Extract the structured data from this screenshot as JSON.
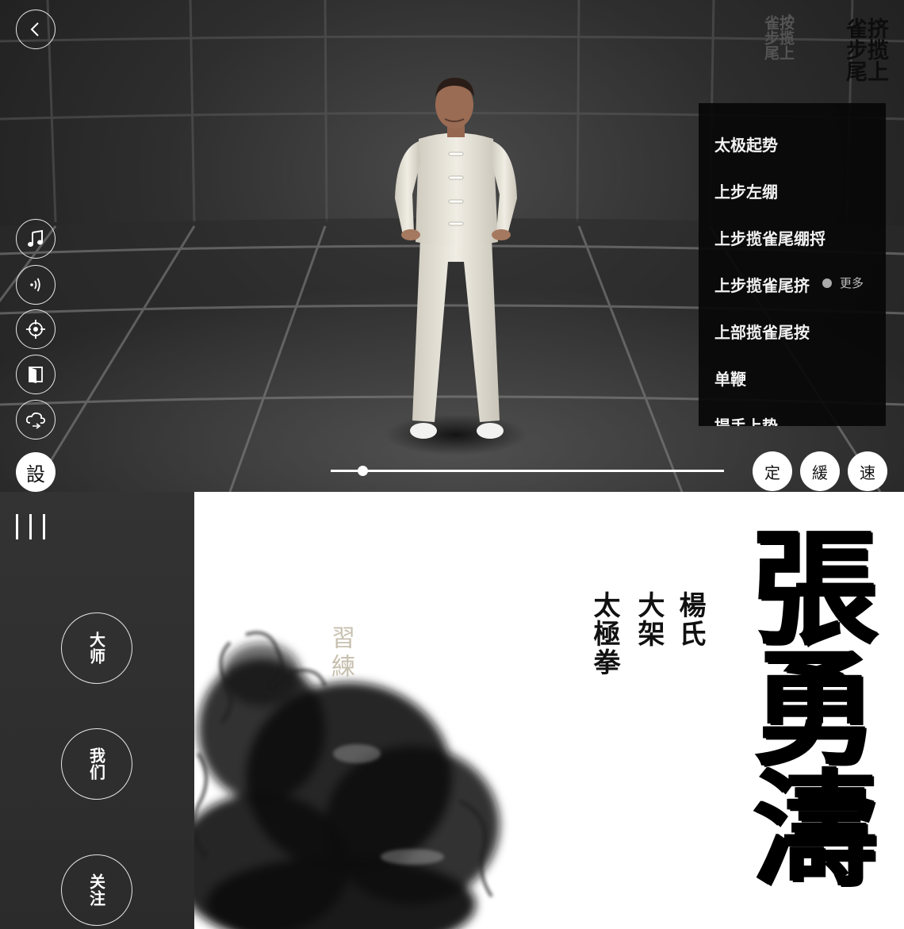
{
  "viewer": {
    "breadcrumb": {
      "previous": "按揽上雀步尾",
      "separator": "›",
      "current": "挤揽上雀步尾"
    },
    "moves": [
      "太极起势",
      "上步左绷",
      "上步揽雀尾绷捋",
      "上步揽雀尾挤",
      "上部揽雀尾按",
      "单鞭",
      "提手上势"
    ],
    "more_label": "更多",
    "toolbar_icons": [
      "music-icon",
      "sound-icon",
      "target-icon",
      "door-icon",
      "cloud-icon"
    ],
    "settings_label": "設",
    "progress": 0.08,
    "speed_buttons": [
      "定",
      "緩",
      "速"
    ]
  },
  "sidebar": {
    "nav": [
      "大师",
      "我们",
      "关注"
    ]
  },
  "hero": {
    "practice_label": "習練",
    "subtitle_lines": [
      "楊氏",
      "大架",
      "太極拳"
    ],
    "name": "張勇濤"
  },
  "colors": {
    "viewer_bg": "#2e2e2e",
    "sidebar_bg": "#2f2f2f",
    "panel_bg": "#080808",
    "accent_beige": "#c7bfae"
  }
}
